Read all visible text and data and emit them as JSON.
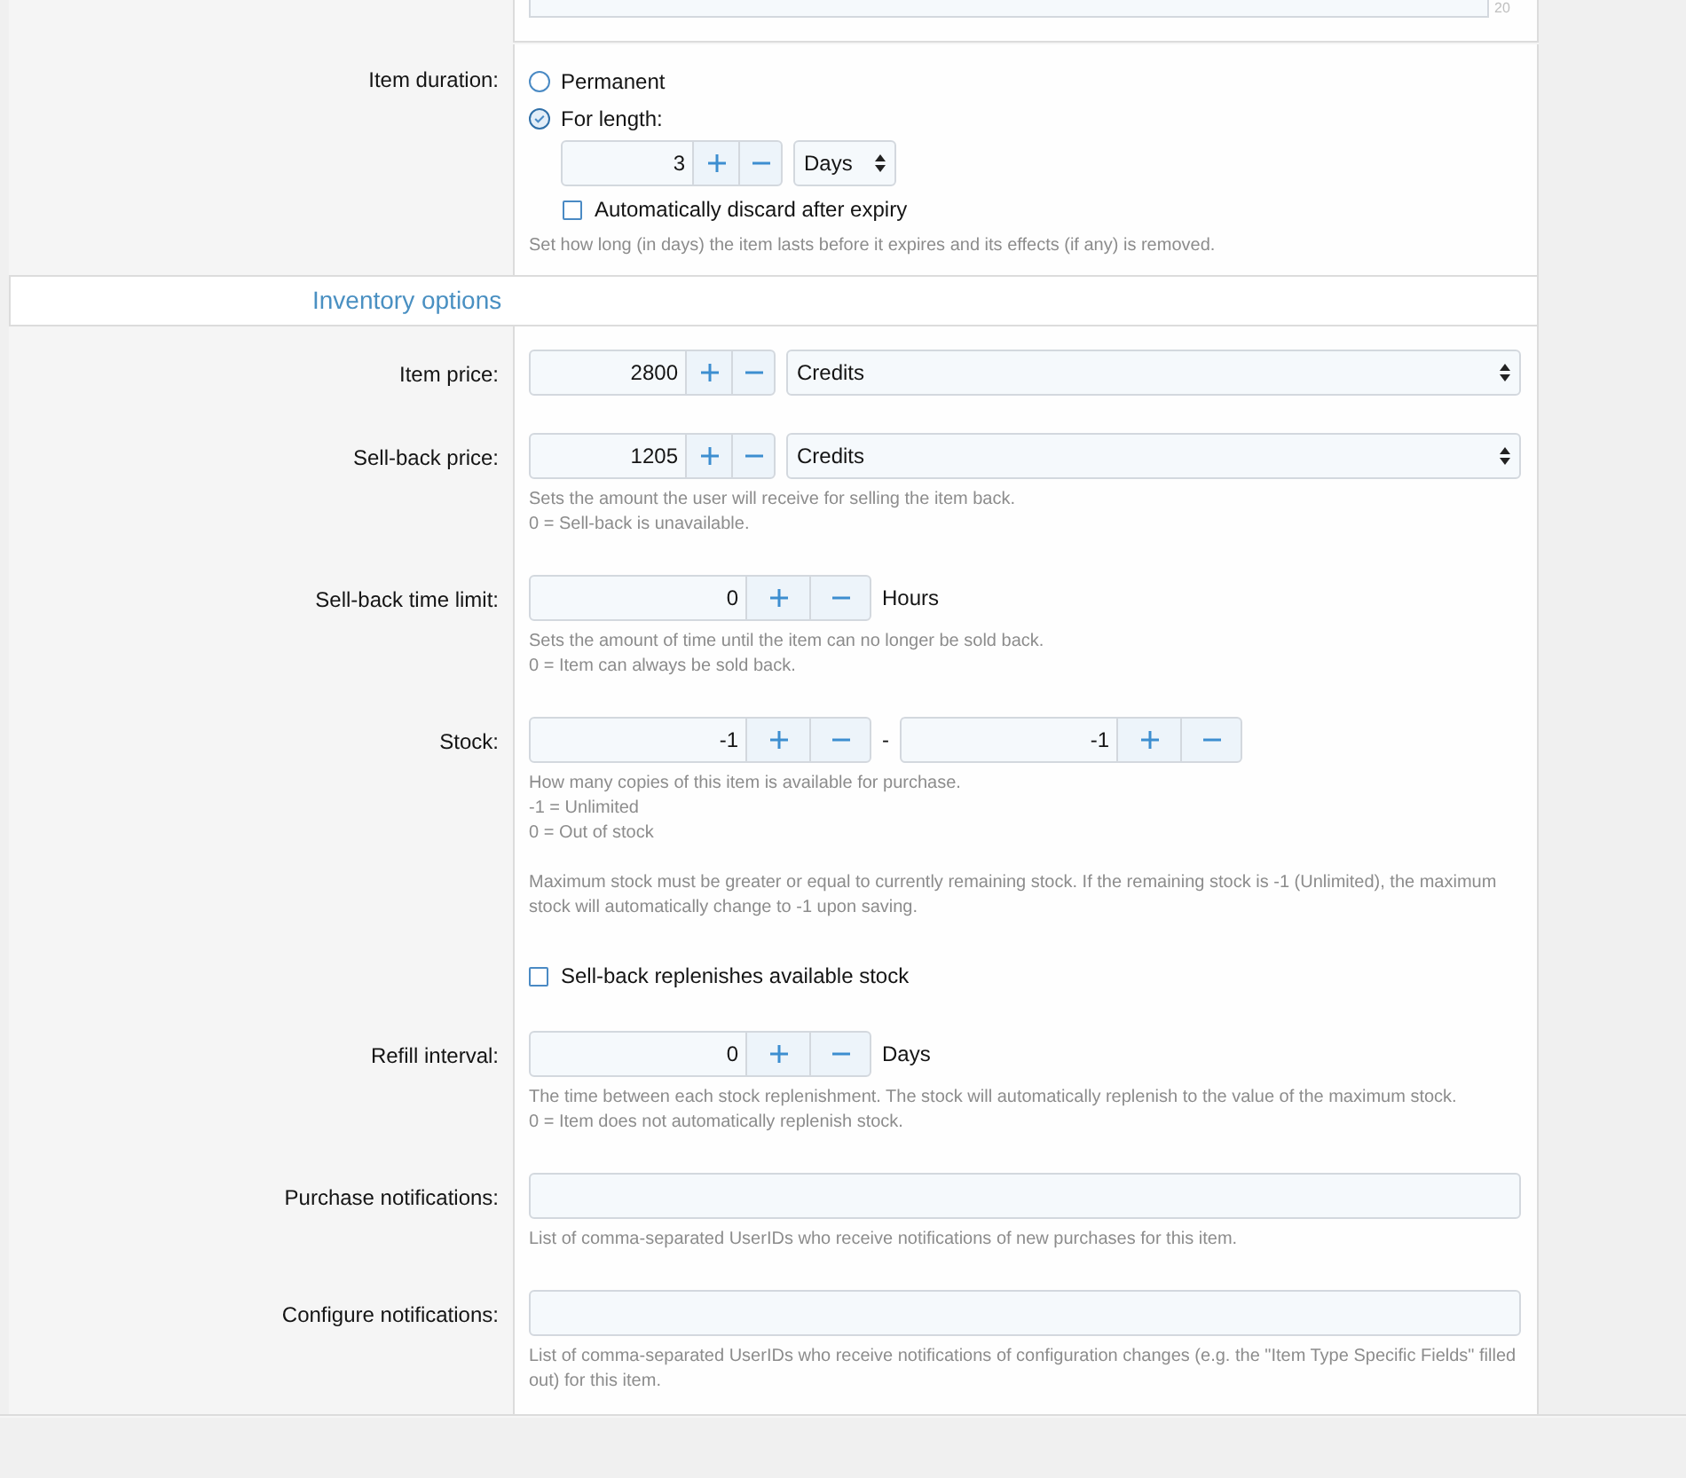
{
  "top_textarea": {
    "counter": "20"
  },
  "duration": {
    "label": "Item duration:",
    "options": [
      {
        "label": "Permanent",
        "selected": false
      },
      {
        "label": "For length:",
        "selected": true
      }
    ],
    "length": {
      "value": "3",
      "unit": "Days"
    },
    "auto_discard": {
      "label": "Automatically discard after expiry",
      "checked": false
    },
    "hint": "Set how long (in days) the item lasts before it expires and its effects (if any) is removed."
  },
  "section_title": "Inventory options",
  "rows": [
    {
      "kind": "price",
      "label": "Item price:",
      "value": "2800",
      "currency": "Credits"
    },
    {
      "kind": "price",
      "label": "Sell-back price:",
      "value": "1205",
      "currency": "Credits",
      "hint": [
        [
          "Sets the amount the user will receive for selling the item back.",
          "0 = Sell-back is unavailable."
        ]
      ]
    },
    {
      "kind": "spinner",
      "label": "Sell-back time limit:",
      "value": "0",
      "unit": "Hours",
      "hint": [
        [
          "Sets the amount of time until the item can no longer be sold back.",
          "0 = Item can always be sold back."
        ]
      ]
    },
    {
      "kind": "range",
      "label": "Stock:",
      "value": "-1",
      "separator": "-",
      "value_2": "-1",
      "hint": [
        [
          "How many copies of this item is available for purchase.",
          "-1 = Unlimited",
          "0 = Out of stock"
        ],
        [
          "Maximum stock must be greater or equal to currently remaining stock. If the remaining stock is -1 (Unlimited), the maximum stock will automatically change to -1 upon saving."
        ]
      ]
    },
    {
      "kind": "checkbox",
      "text": "Sell-back replenishes available stock",
      "checked": false
    },
    {
      "kind": "spinner",
      "label": "Refill interval:",
      "value": "0",
      "unit": "Days",
      "hint": [
        [
          "The time between each stock replenishment. The stock will automatically replenish to the value of the maximum stock.",
          "0 = Item does not automatically replenish stock."
        ]
      ]
    },
    {
      "kind": "text",
      "label": "Purchase notifications:",
      "hint": [
        [
          "List of comma-separated UserIDs who receive notifications of new purchases for this item."
        ]
      ]
    },
    {
      "kind": "text",
      "label": "Configure notifications:",
      "hint": [
        [
          "List of comma-separated UserIDs who receive notifications of configuration changes (e.g. the \"Item Type Specific Fields\" filled out) for this item."
        ]
      ]
    }
  ]
}
